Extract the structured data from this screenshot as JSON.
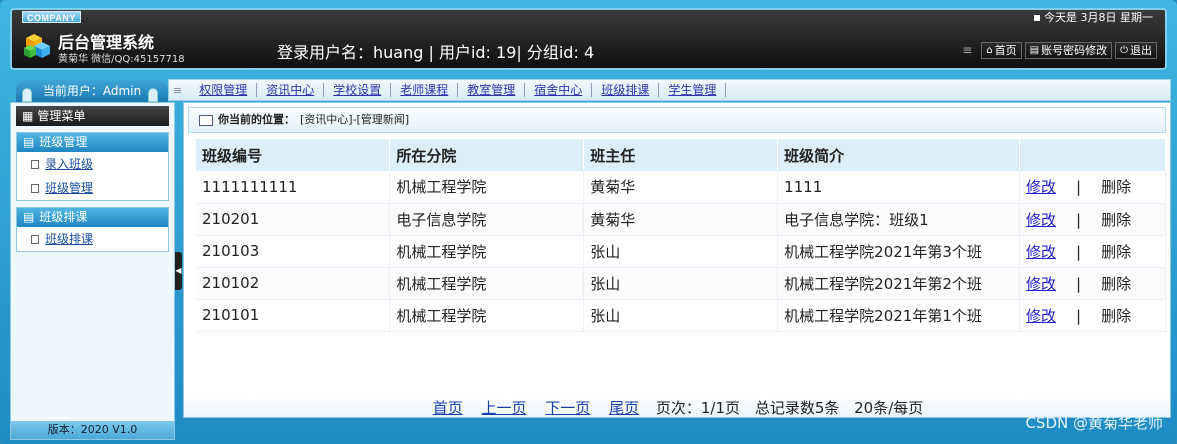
{
  "header": {
    "company": "COMPANY",
    "date_text": "今天是 3月8日 星期一",
    "system_title": "后台管理系统",
    "system_subtitle": "黄菊华 微信/QQ:45157718",
    "login_info": "登录用户名：huang | 用户id: 19| 分组id: 4",
    "buttons": [
      {
        "label": "首页",
        "icon": "home-icon"
      },
      {
        "label": "账号密码修改",
        "icon": "doc-icon"
      },
      {
        "label": "退出",
        "icon": "power-icon"
      }
    ]
  },
  "sidebar": {
    "current_user": "当前用户：Admin",
    "menu_title": "管理菜单",
    "groups": [
      {
        "title": "班级管理",
        "items": [
          "录入班级",
          "班级管理"
        ]
      },
      {
        "title": "班级排课",
        "items": [
          "班级排课"
        ]
      }
    ],
    "version": "版本：2020 V1.0"
  },
  "topnav": {
    "items": [
      "权限管理",
      "资讯中心",
      "学校设置",
      "老师课程",
      "教室管理",
      "宿舍中心",
      "班级排课",
      "学生管理"
    ]
  },
  "breadcrumb": {
    "label": "你当前的位置：",
    "path": "[资讯中心]-[管理新闻]"
  },
  "table": {
    "headers": [
      "班级编号",
      "所在分院",
      "班主任",
      "班级简介",
      ""
    ],
    "rows": [
      [
        "1111111111",
        "机械工程学院",
        "黄菊华",
        "1111"
      ],
      [
        "210201",
        "电子信息学院",
        "黄菊华",
        "电子信息学院：班级1"
      ],
      [
        "210103",
        "机械工程学院",
        "张山",
        "机械工程学院2021年第3个班"
      ],
      [
        "210102",
        "机械工程学院",
        "张山",
        "机械工程学院2021年第2个班"
      ],
      [
        "210101",
        "机械工程学院",
        "张山",
        "机械工程学院2021年第1个班"
      ]
    ],
    "edit_label": "修改",
    "separator": "|",
    "delete_label": "删除"
  },
  "pager": {
    "first": "首页",
    "prev": "上一页",
    "next": "下一页",
    "last": "尾页",
    "page_info": "页次：1/1页",
    "total": "总记录数5条",
    "per_page": "20条/每页"
  },
  "watermark": "CSDN @黄菊华老师"
}
